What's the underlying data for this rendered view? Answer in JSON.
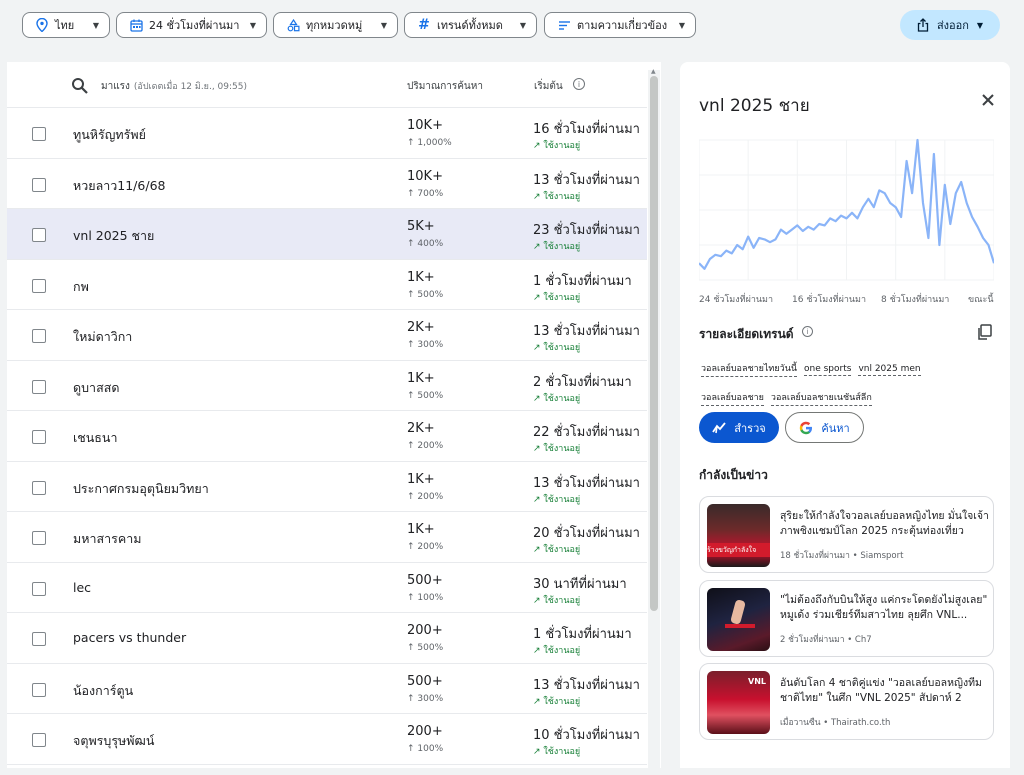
{
  "filters": {
    "country": "ไทย",
    "time_range": "24 ชั่วโมงที่ผ่านมา",
    "category": "ทุกหมวดหมู่",
    "trend_type": "เทรนด์ทั้งหมด",
    "sort": "ตามความเกี่ยวข้อง",
    "export_label": "ส่งออก"
  },
  "list_header": {
    "title": "มาแรง",
    "updated": "(อัปเดตเมื่อ 12 มิ.ย., 09:55)",
    "volume_col": "ปริมาณการค้นหา",
    "started_col": "เริ่มต้น",
    "info": "i"
  },
  "rows": [
    {
      "name": "ทูนหิรัญทรัพย์",
      "volume": "10K+",
      "change": "↑ 1,000%",
      "started": "16 ชั่วโมงที่ผ่านมา",
      "status": "↗ ใช้งานอยู่"
    },
    {
      "name": "หวยลาว11/6/68",
      "volume": "10K+",
      "change": "↑ 700%",
      "started": "13 ชั่วโมงที่ผ่านมา",
      "status": "↗ ใช้งานอยู่"
    },
    {
      "name": "vnl 2025 ชาย",
      "volume": "5K+",
      "change": "↑ 400%",
      "started": "23 ชั่วโมงที่ผ่านมา",
      "status": "↗ ใช้งานอยู่"
    },
    {
      "name": "กพ",
      "volume": "1K+",
      "change": "↑ 500%",
      "started": "1 ชั่วโมงที่ผ่านมา",
      "status": "↗ ใช้งานอยู่"
    },
    {
      "name": "ใหม่ดาวิกา",
      "volume": "2K+",
      "change": "↑ 300%",
      "started": "13 ชั่วโมงที่ผ่านมา",
      "status": "↗ ใช้งานอยู่"
    },
    {
      "name": "ดูบาสสด",
      "volume": "1K+",
      "change": "↑ 500%",
      "started": "2 ชั่วโมงที่ผ่านมา",
      "status": "↗ ใช้งานอยู่"
    },
    {
      "name": "เชนธนา",
      "volume": "2K+",
      "change": "↑ 200%",
      "started": "22 ชั่วโมงที่ผ่านมา",
      "status": "↗ ใช้งานอยู่"
    },
    {
      "name": "ประกาศกรมอุตุนิยมวิทยา",
      "volume": "1K+",
      "change": "↑ 200%",
      "started": "13 ชั่วโมงที่ผ่านมา",
      "status": "↗ ใช้งานอยู่"
    },
    {
      "name": "มหาสารคาม",
      "volume": "1K+",
      "change": "↑ 200%",
      "started": "20 ชั่วโมงที่ผ่านมา",
      "status": "↗ ใช้งานอยู่"
    },
    {
      "name": "lec",
      "volume": "500+",
      "change": "↑ 100%",
      "started": "30 นาทีที่ผ่านมา",
      "status": "↗ ใช้งานอยู่"
    },
    {
      "name": "pacers vs thunder",
      "volume": "200+",
      "change": "↑ 500%",
      "started": "1 ชั่วโมงที่ผ่านมา",
      "status": "↗ ใช้งานอยู่"
    },
    {
      "name": "น้องการ์ตูน",
      "volume": "500+",
      "change": "↑ 300%",
      "started": "13 ชั่วโมงที่ผ่านมา",
      "status": "↗ ใช้งานอยู่"
    },
    {
      "name": "จตุพรบุรุษพัฒน์",
      "volume": "200+",
      "change": "↑ 100%",
      "started": "10 ชั่วโมงที่ผ่านมา",
      "status": "↗ ใช้งานอยู่"
    }
  ],
  "selected_row": 2,
  "detail": {
    "title": "vnl 2025 ชาย",
    "x_labels": [
      "24 ชั่วโมงที่ผ่านมา",
      "16 ชั่วโมงที่ผ่านมา",
      "8 ชั่วโมงที่ผ่านมา",
      "ขณะนี้"
    ],
    "trend_details_title": "รายละเอียดเทรนด์",
    "tags": [
      "วอลเลย์บอลชายไทยวันนี้",
      "one sports",
      "vnl 2025 men",
      "วอลเลย์บอลชาย",
      "วอลเลย์บอลชายเนชันส์ลีก"
    ],
    "explore_label": "สำรวจ",
    "search_label": "ค้นหา",
    "news_title": "กำลังเป็นข่าว",
    "news": [
      {
        "headline": "สุริยะให้กำลังใจวอลเลย์บอลหญิงไทย มั่นใจเจ้าภาพชิงแชมป์โลก 2025 กระตุ้นท่องเที่ยว",
        "meta": "18 ชั่วโมงที่ผ่านมา • Siamsport",
        "thumb_text": "ร้างขวัญกำลังใจ"
      },
      {
        "headline": "\"ไม่ต้องถึงกับบินให้สูง แค่กระโดดยังไม่สูงเลย\" หมูเด้ง ร่วมเชียร์ทีมสาวไทย ลุยศึก VNL...",
        "meta": "2 ชั่วโมงที่ผ่านมา • Ch7",
        "thumb_text": ""
      },
      {
        "headline": "อันดับโลก 4 ชาติคู่แข่ง \"วอลเลย์บอลหญิงทีมชาติไทย\" ในศึก \"VNL 2025\" สัปดาห์ 2",
        "meta": "เมื่อวานซืน • Thairath.co.th",
        "thumb_text": "VNL"
      }
    ]
  },
  "chart_data": {
    "type": "line",
    "x_unit": "hours ago",
    "x": [
      24,
      23.5,
      23,
      22.5,
      22,
      21.5,
      21,
      20.5,
      20,
      19.5,
      19,
      18.5,
      18,
      17.5,
      17,
      16.5,
      16,
      15.5,
      15,
      14.5,
      14,
      13.5,
      13,
      12.5,
      12,
      11.5,
      11,
      10.5,
      10,
      9.5,
      9,
      8.5,
      8,
      7.5,
      7,
      6.5,
      6,
      5.5,
      5,
      4.5,
      4,
      3.5,
      3,
      2.5,
      2,
      1.5,
      1,
      0.5,
      0
    ],
    "values": [
      12,
      8,
      15,
      18,
      17,
      21,
      19,
      25,
      22,
      31,
      23,
      30,
      29,
      27,
      29,
      36,
      33,
      36,
      39,
      35,
      38,
      36,
      40,
      39,
      44,
      42,
      46,
      44,
      48,
      44,
      52,
      58,
      52,
      64,
      62,
      55,
      52,
      45,
      85,
      62,
      100,
      55,
      30,
      90,
      25,
      68,
      40,
      62,
      70,
      55,
      45,
      38,
      30,
      25,
      12
    ],
    "ylim": [
      0,
      100
    ],
    "grid": true,
    "line_color": "#8ab4f8"
  }
}
